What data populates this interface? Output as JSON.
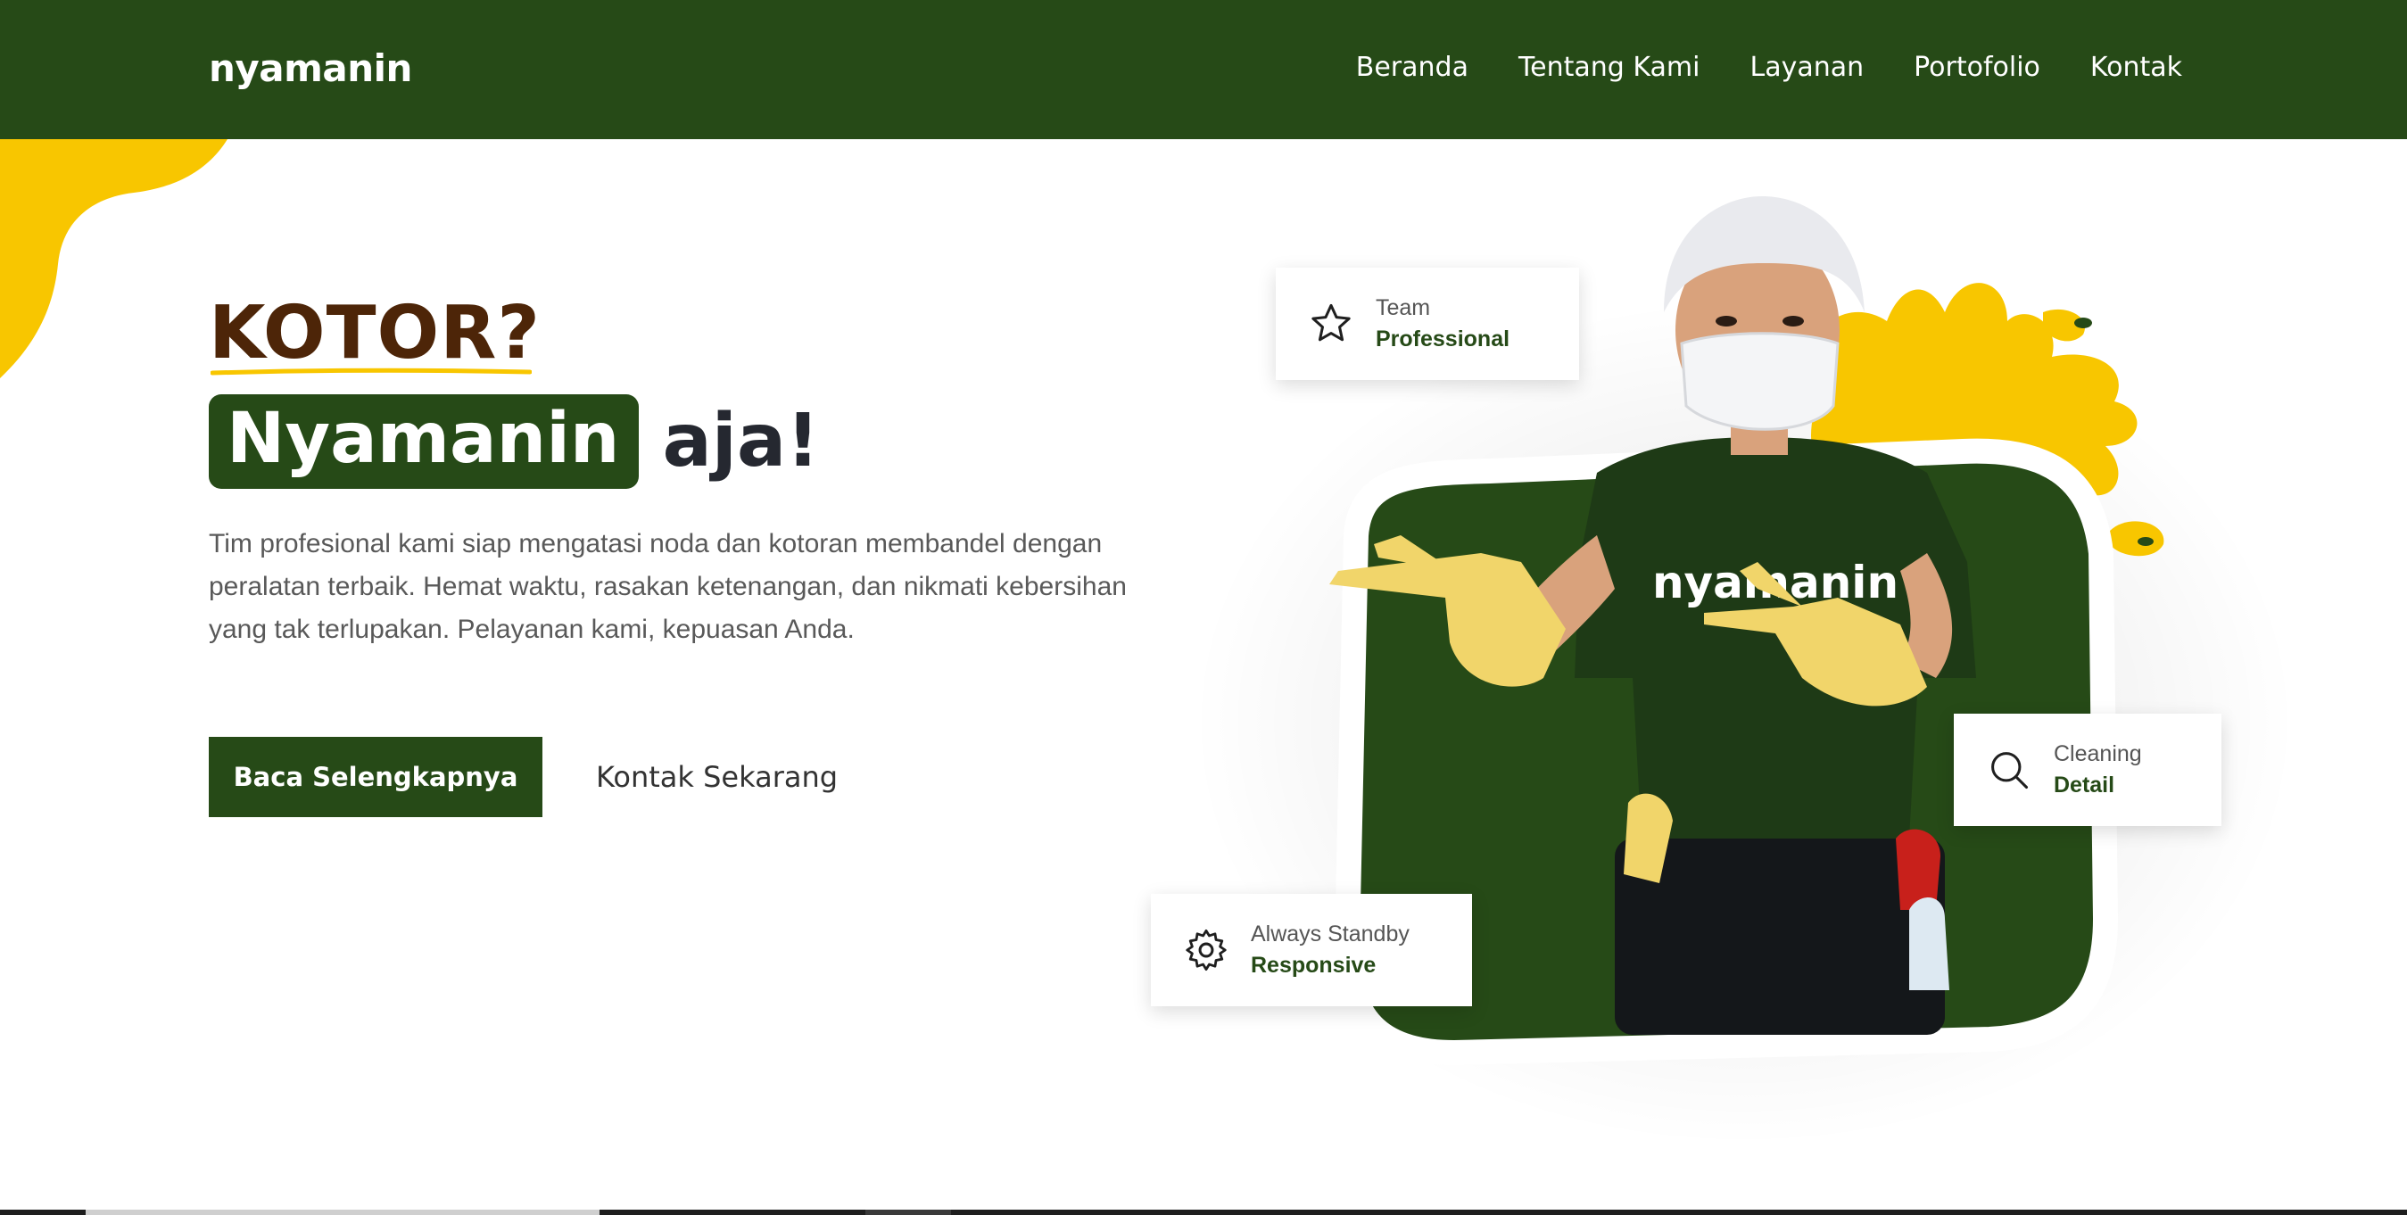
{
  "header": {
    "logo": "nyamanin",
    "nav": [
      "Beranda",
      "Tentang Kami",
      "Layanan",
      "Portofolio",
      "Kontak"
    ]
  },
  "hero": {
    "line1": "KOTOR?",
    "brand_highlight": "Nyamanin",
    "line2_suffix": "aja!",
    "description": "Tim profesional kami siap mengatasi noda dan kotoran membandel dengan peralatan terbaik. Hemat waktu, rasakan ketenangan, dan nikmati kebersihan yang tak terlupakan. Pelayanan kami, kepuasan Anda.",
    "primary_button": "Baca Selengkapnya",
    "secondary_button": "Kontak Sekarang",
    "shirt_text": "nyamanin"
  },
  "cards": {
    "team": {
      "small": "Team",
      "big": "Professional",
      "icon": "star-icon"
    },
    "cleaning": {
      "small": "Cleaning",
      "big": "Detail",
      "icon": "search-icon"
    },
    "standby": {
      "small": "Always Standby",
      "big": "Responsive",
      "icon": "gear-icon"
    }
  },
  "colors": {
    "brand_green": "#264a17",
    "accent_yellow": "#f8c600",
    "kotor_brown": "#4d2508"
  }
}
